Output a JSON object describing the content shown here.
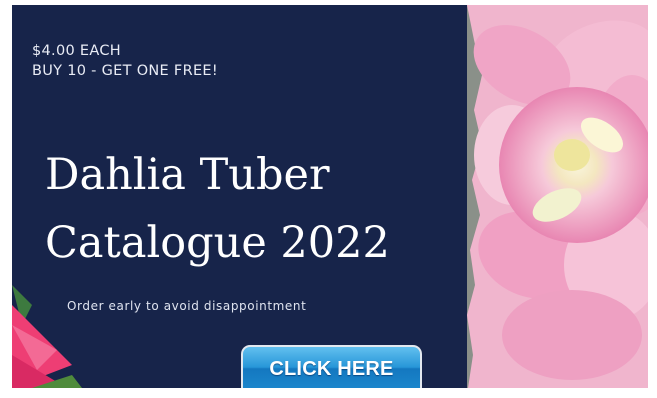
{
  "promo": {
    "price_line_1": "$4.00 EACH",
    "price_line_2": "BUY 10 - GET ONE FREE!"
  },
  "title": {
    "line_1": "Dahlia Tuber",
    "line_2": "Catalogue 2022"
  },
  "tagline": "Order early to avoid disappointment",
  "cta": {
    "label": "CLICK HERE"
  },
  "colors": {
    "panel_navy": "#17244a",
    "flower_pink": "#f2a7c7",
    "flower_center": "#f3eec2",
    "button_blue": "#2796d8"
  }
}
